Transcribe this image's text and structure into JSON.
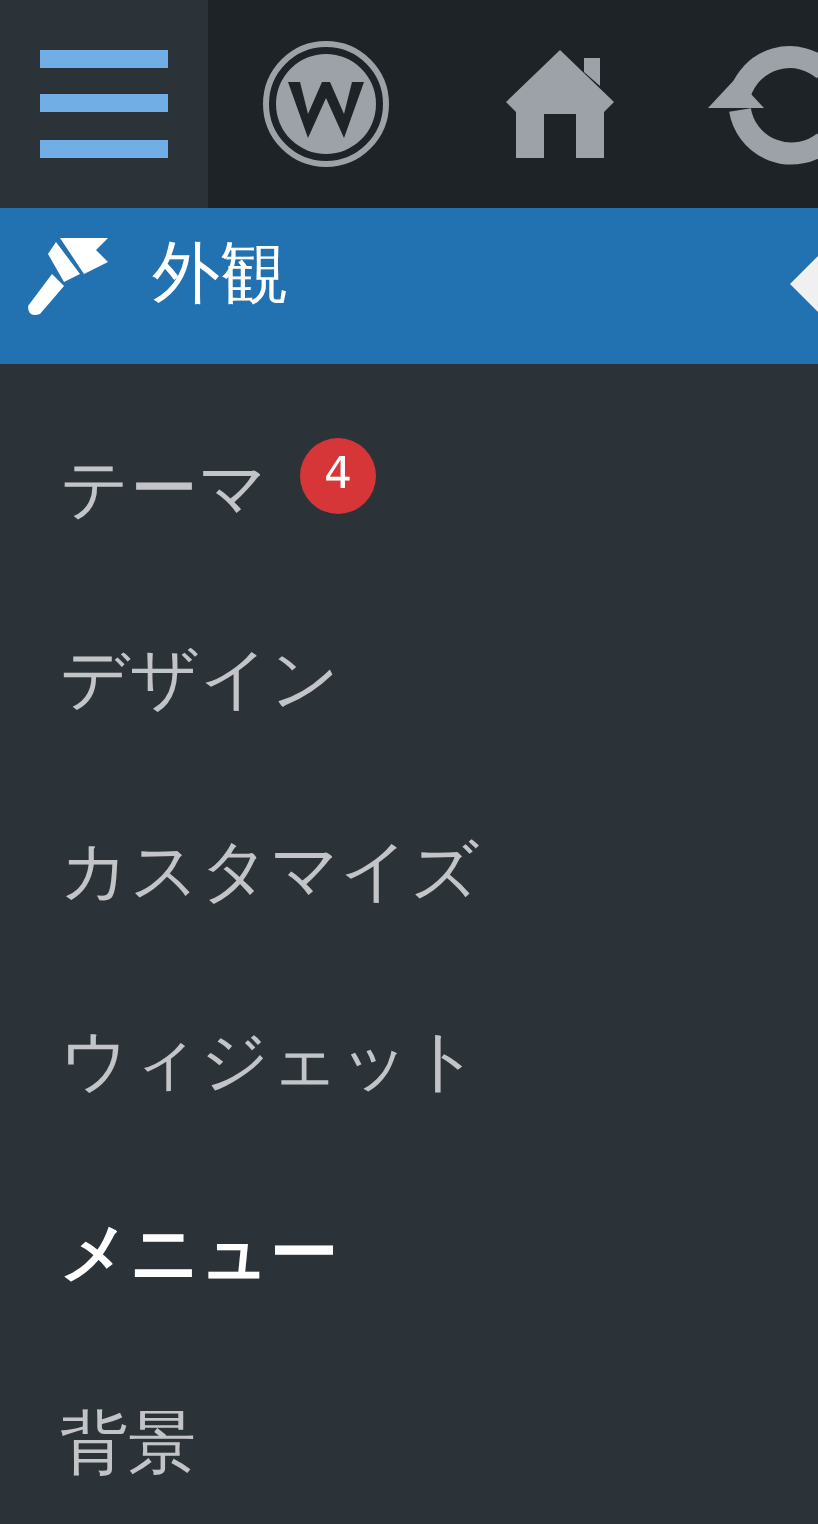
{
  "menu": {
    "label": "外観",
    "submenu": [
      {
        "label": "テーマ",
        "badge": "4",
        "selected": false
      },
      {
        "label": "デザイン",
        "selected": false
      },
      {
        "label": "カスタマイズ",
        "selected": false
      },
      {
        "label": "ウィジェット",
        "selected": false
      },
      {
        "label": "メニュー",
        "selected": true
      },
      {
        "label": "背景",
        "selected": false
      }
    ]
  }
}
